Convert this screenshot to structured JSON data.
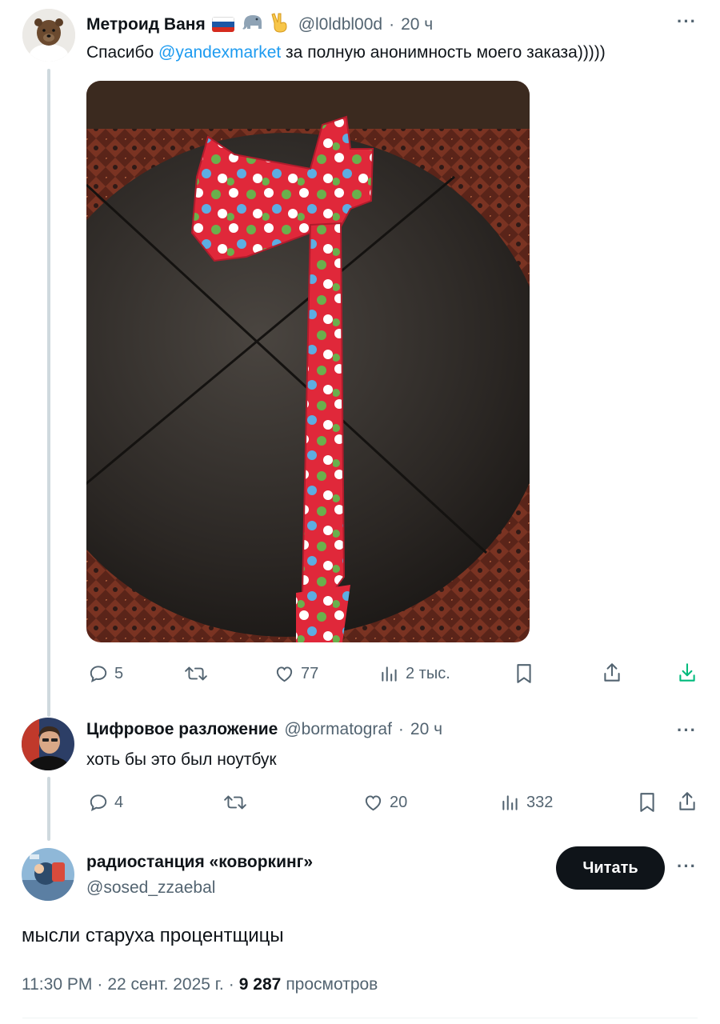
{
  "tweet1": {
    "name": "Метроид Ваня",
    "handle": "@l0ldbl00d",
    "sep": "·",
    "time": "20 ч",
    "text_before": "Спасибо ",
    "mention": "@yandexmarket",
    "text_after": " за полную анонимность моего заказа)))))",
    "flag_emoji": "🇷🇺",
    "elephant_emoji": "🐘",
    "victory_emoji": "✌",
    "stats": {
      "replies": "5",
      "likes": "77",
      "views": "2 тыс."
    }
  },
  "tweet2": {
    "name": "Цифровое разложение",
    "handle": "@bormatograf",
    "sep": "·",
    "time": "20 ч",
    "text": "хоть бы это был ноутбук",
    "stats": {
      "replies": "4",
      "likes": "20",
      "views": "332"
    }
  },
  "tweet3": {
    "name": "радиостанция «коворкинг»",
    "handle": "@sosed_zzaebal",
    "follow_label": "Читать",
    "text": "мысли старуха процентщицы",
    "time": "11:30 PM",
    "sep1": "·",
    "date": "22 сент. 2025 г.",
    "sep2": "·",
    "views_count": "9 287",
    "views_label": "просмотров"
  },
  "more_label": "···",
  "colors": {
    "accent": "#1d9bf0",
    "muted": "#536471",
    "text": "#0f1419",
    "download": "#00ba7c"
  }
}
